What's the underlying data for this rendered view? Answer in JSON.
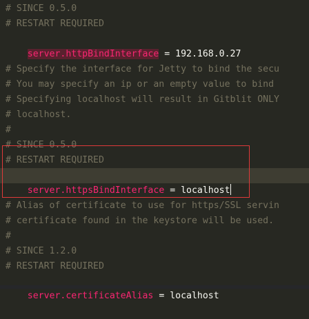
{
  "editor": {
    "l1": "# SINCE 0.5.0",
    "l2": "# RESTART REQUIRED",
    "l3": {
      "key": "server.httpBindInterface",
      "op": " = ",
      "val": "192.168.0.27"
    },
    "l5": "# Specify the interface for Jetty to bind the secu",
    "l6": "# You may specify an ip or an empty value to bind",
    "l7": "# Specifying localhost will result in Gitblit ONLY",
    "l8": "# localhost.",
    "l9": "#",
    "l10": "# SINCE 0.5.0",
    "l11": "# RESTART REQUIRED",
    "l12": {
      "key": "server.httpsBindInterface",
      "op": " = ",
      "val": "localhost"
    },
    "l14": "# Alias of certificate to use for https/SSL servin",
    "l15": "# certificate found in the keystore will be used.",
    "l16": "#",
    "l17": "# SINCE 1.2.0",
    "l18": "# RESTART REQUIRED",
    "l19": {
      "key": "server.certificateAlias",
      "op": " = ",
      "val": "localhost"
    }
  },
  "colors": {
    "background": "#272822",
    "comment": "#75715e",
    "key": "#f92672",
    "text": "#f8f8f2",
    "current_line": "#3e3d32",
    "annotation_box": "#e03a3a"
  }
}
